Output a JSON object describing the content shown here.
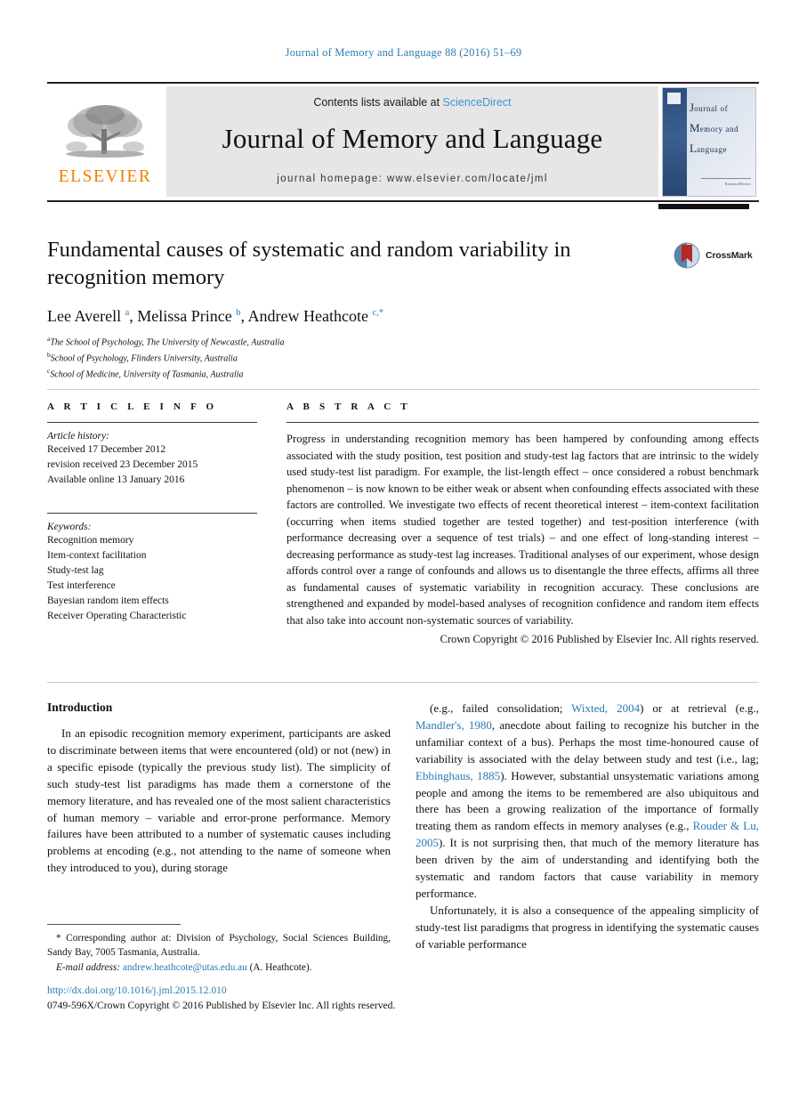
{
  "running_head": "Journal of Memory and Language 88 (2016) 51–69",
  "masthead": {
    "contents_prefix": "Contents lists available at ",
    "sciencedirect": "ScienceDirect",
    "journal_title": "Journal of Memory and Language",
    "homepage": "journal homepage: www.elsevier.com/locate/jml",
    "publisher_wordmark": "ELSEVIER",
    "cover": {
      "line1_big": "J",
      "line1_rest": "ournal of",
      "line2_big": "M",
      "line2_rest": "emory and",
      "line3_big": "L",
      "line3_rest": "anguage",
      "footer": "ScienceDirect"
    },
    "accent_color": "#3f96d0",
    "elsevier_orange": "#f08000"
  },
  "article": {
    "title": "Fundamental causes of systematic and random variability in recognition memory",
    "authors_html": "Lee Averell <sup>a</sup>, Melissa Prince <sup>b</sup>, Andrew Heathcote <sup>c,*</sup>",
    "authors_plain": "Lee Averell a, Melissa Prince b, Andrew Heathcote c,*",
    "affiliations": [
      {
        "marker": "a",
        "text": "The School of Psychology, The University of Newcastle, Australia"
      },
      {
        "marker": "b",
        "text": "School of Psychology, Flinders University, Australia"
      },
      {
        "marker": "c",
        "text": "School of Medicine, University of Tasmania, Australia"
      }
    ],
    "crossmark_label": "CrossMark"
  },
  "article_info": {
    "heading": "A R T I C L E    I N F O",
    "history_label": "Article history:",
    "history_lines": [
      "Received 17 December 2012",
      "revision received 23 December 2015",
      "Available online 13 January 2016"
    ],
    "keywords_label": "Keywords:",
    "keywords": [
      "Recognition memory",
      "Item-context facilitation",
      "Study-test lag",
      "Test interference",
      "Bayesian random item effects",
      "Receiver Operating Characteristic"
    ]
  },
  "abstract": {
    "heading": "A B S T R A C T",
    "text": "Progress in understanding recognition memory has been hampered by confounding among effects associated with the study position, test position and study-test lag factors that are intrinsic to the widely used study-test list paradigm. For example, the list-length effect – once considered a robust benchmark phenomenon – is now known to be either weak or absent when confounding effects associated with these factors are controlled. We investigate two effects of recent theoretical interest – item-context facilitation (occurring when items studied together are tested together) and test-position interference (with performance decreasing over a sequence of test trials) – and one effect of long-standing interest – decreasing performance as study-test lag increases. Traditional analyses of our experiment, whose design affords control over a range of confounds and allows us to disentangle the three effects, affirms all three as fundamental causes of systematic variability in recognition accuracy. These conclusions are strengthened and expanded by model-based analyses of recognition confidence and random item effects that also take into account non-systematic sources of variability.",
    "copyright": "Crown Copyright © 2016 Published by Elsevier Inc. All rights reserved."
  },
  "body": {
    "intro_heading": "Introduction",
    "left_paragraphs": [
      "In an episodic recognition memory experiment, participants are asked to discriminate between items that were encountered (old) or not (new) in a specific episode (typically the previous study list). The simplicity of such study-test list paradigms has made them a cornerstone of the memory literature, and has revealed one of the most salient characteristics of human memory – variable and error-prone performance. Memory failures have been attributed to a number of systematic causes including problems at encoding (e.g., not attending to the name of someone when they introduced to you), during storage"
    ],
    "right_paragraph_1_parts": [
      {
        "t": "(e.g., failed consolidation; ",
        "ref": false
      },
      {
        "t": "Wixted, 2004",
        "ref": true
      },
      {
        "t": ") or at retrieval (e.g., ",
        "ref": false
      },
      {
        "t": "Mandler's, 1980",
        "ref": true
      },
      {
        "t": ", anecdote about failing to recognize his butcher in the unfamiliar context of a bus). Perhaps the most time-honoured cause of variability is associated with the delay between study and test (i.e., lag; ",
        "ref": false
      },
      {
        "t": "Ebbinghaus, 1885",
        "ref": true
      },
      {
        "t": "). However, substantial unsystematic variations among people and among the items to be remembered are also ubiquitous and there has been a growing realization of the importance of formally treating them as random effects in memory analyses (e.g., ",
        "ref": false
      },
      {
        "t": "Rouder & Lu, 2005",
        "ref": true
      },
      {
        "t": "). It is not surprising then, that much of the memory literature has been driven by the aim of understanding and identifying both the systematic and random factors that cause variability in memory performance.",
        "ref": false
      }
    ],
    "right_paragraph_2": "Unfortunately, it is also a consequence of the appealing simplicity of study-test list paradigms that progress in identifying the systematic causes of variable performance"
  },
  "footnote": {
    "corresponding": "* Corresponding author at: Division of Psychology, Social Sciences Building, Sandy Bay, 7005 Tasmania, Australia.",
    "email_label": "E-mail address:",
    "email": "andrew.heathcote@utas.edu.au",
    "email_suffix": "(A. Heathcote)."
  },
  "publication_footer": {
    "doi": "http://dx.doi.org/10.1016/j.jml.2015.12.010",
    "issn_line": "0749-596X/Crown Copyright © 2016 Published by Elsevier Inc. All rights reserved."
  }
}
